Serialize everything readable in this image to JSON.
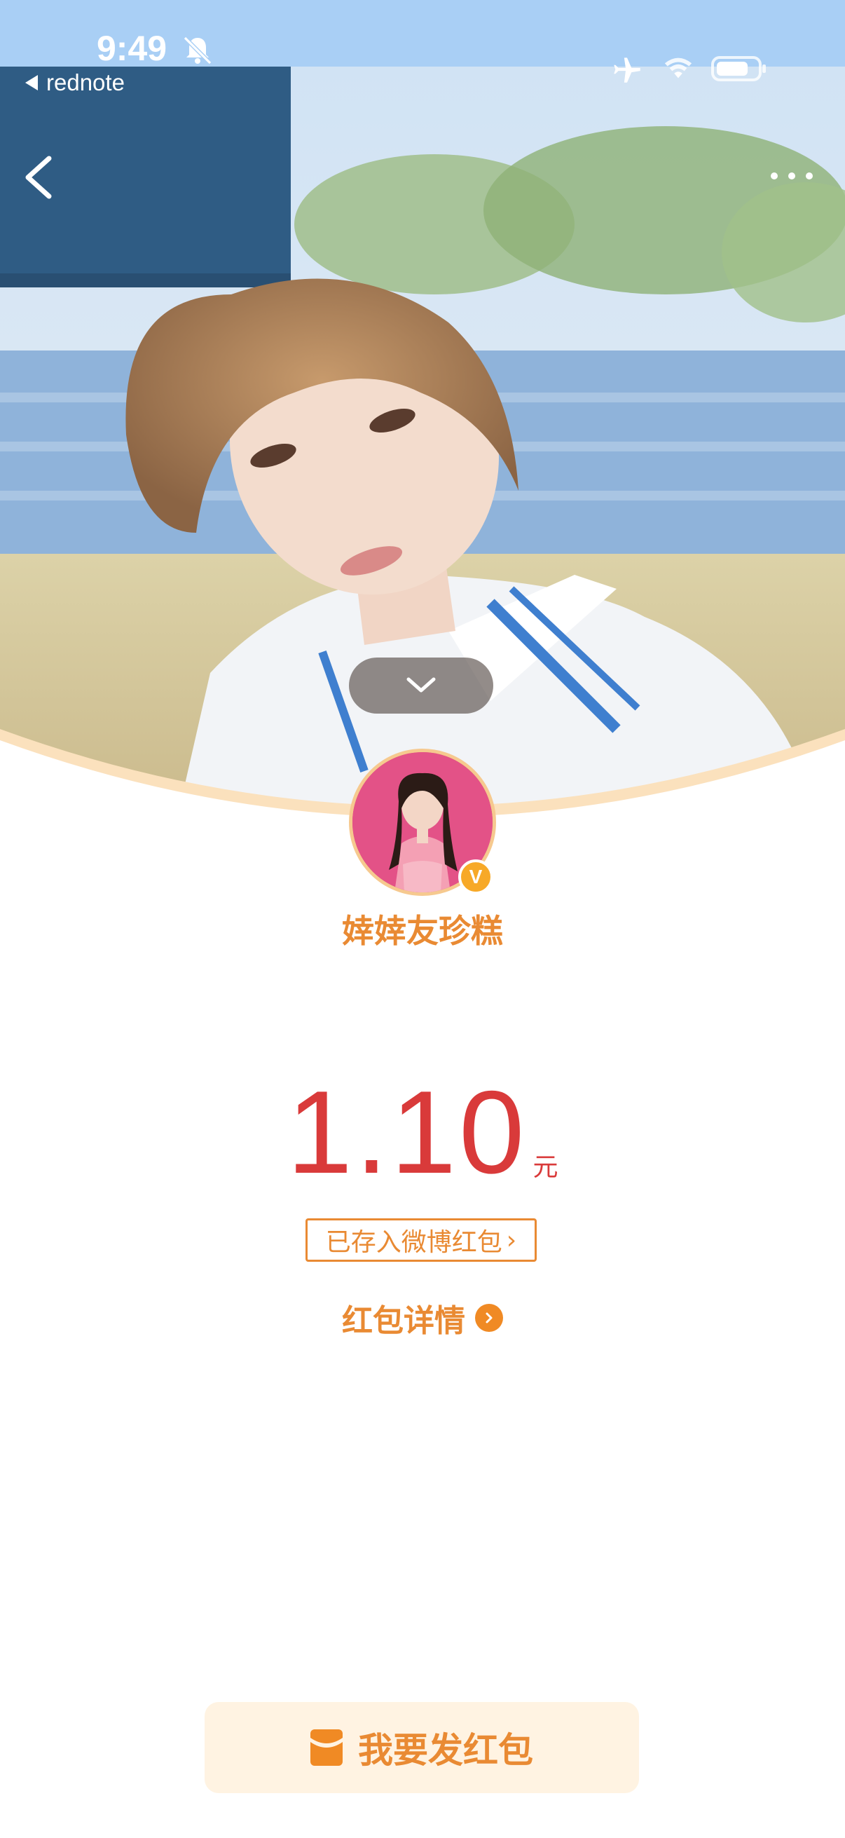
{
  "status_bar": {
    "time": "9:49",
    "back_app": "rednote"
  },
  "sender": {
    "name": "婞婞友珍糕",
    "verified_badge": "V"
  },
  "amount": {
    "value": "1.10",
    "unit": "元"
  },
  "saved_link": {
    "label": "已存入微博红包",
    "chevron": "›"
  },
  "details_link": {
    "label": "红包详情"
  },
  "send_button": {
    "label": "我要发红包"
  },
  "icons": {
    "bell": "bell-slash-icon",
    "airplane": "airplane-icon",
    "wifi": "wifi-icon",
    "battery": "battery-icon",
    "back": "chevron-left-icon",
    "more": "more-dots-icon",
    "collapse": "chevron-down-icon",
    "details": "chevron-right-icon",
    "envelope": "red-envelope-icon"
  },
  "colors": {
    "accent": "#e98a33",
    "amount": "#d93a3a",
    "button_bg": "#fff3e2",
    "status_bar": "#a9cff5"
  }
}
